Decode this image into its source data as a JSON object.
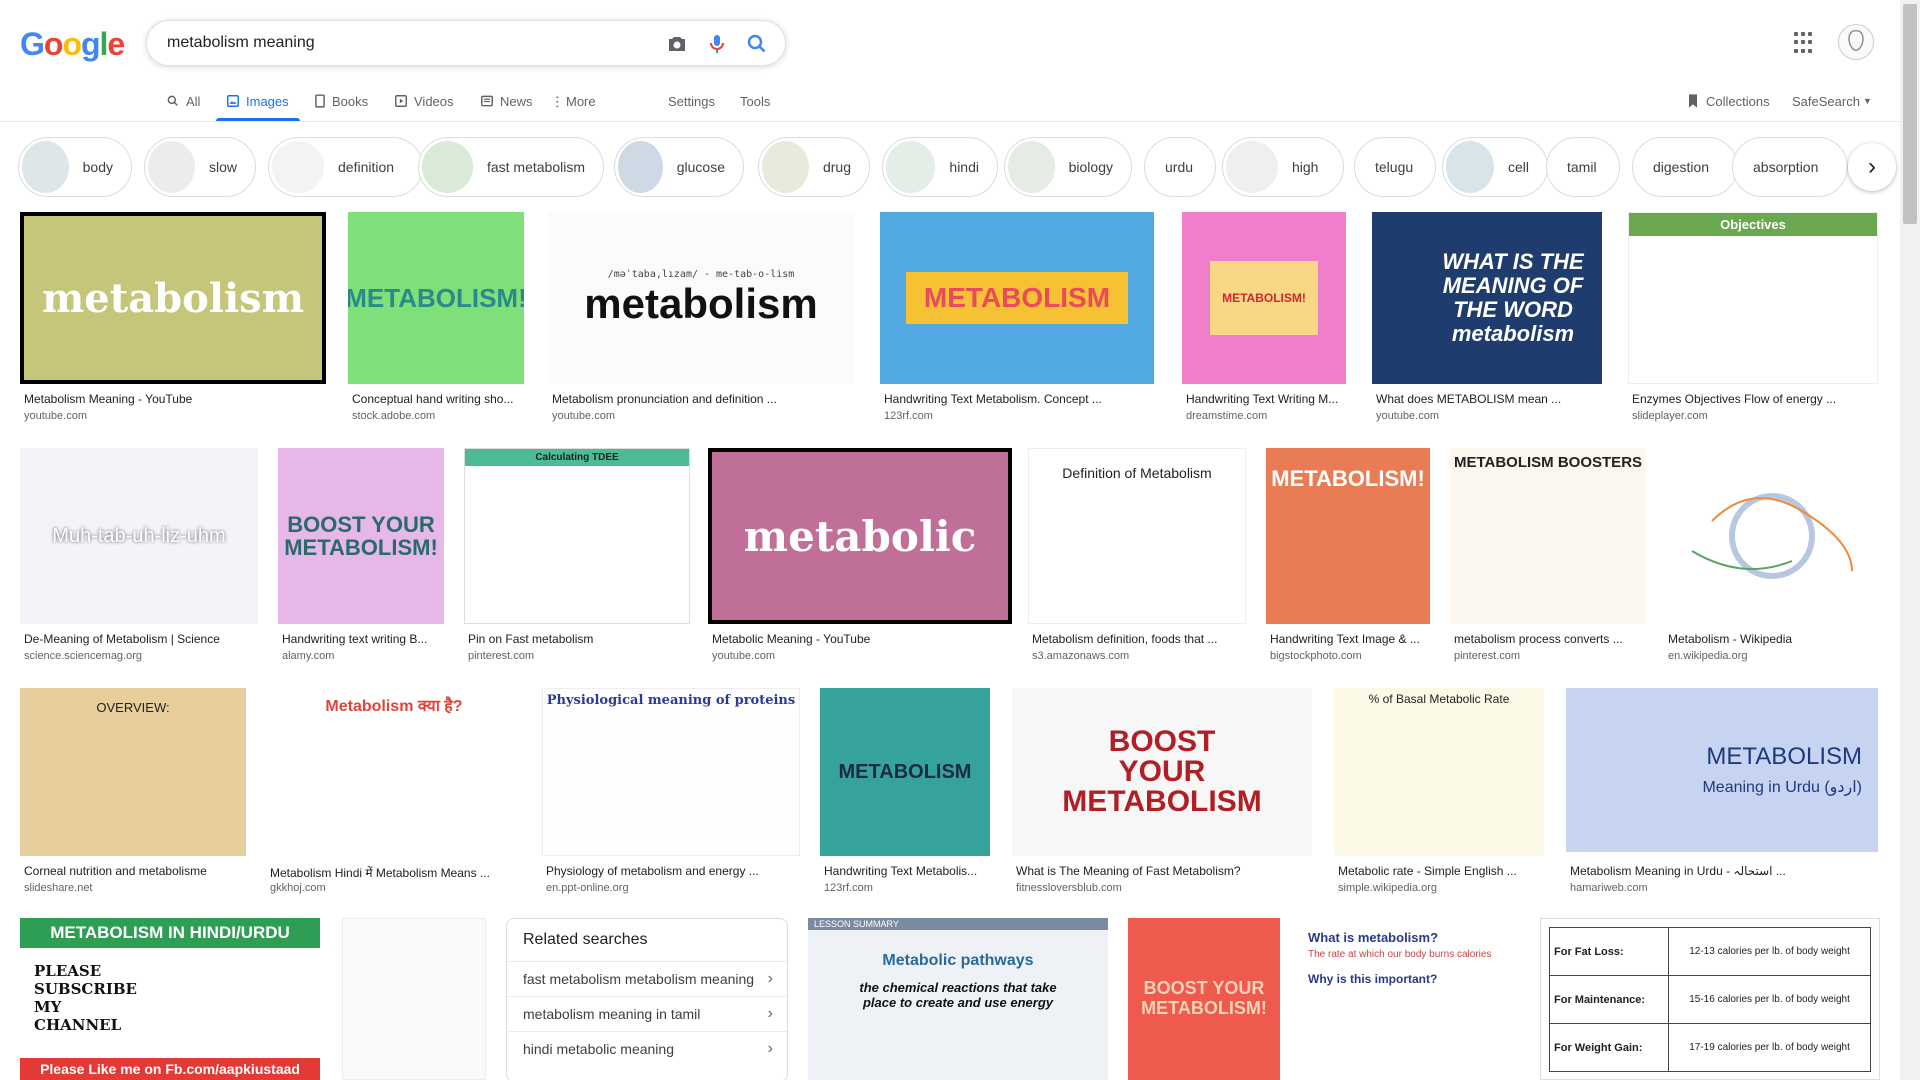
{
  "logo": {
    "letters": [
      "G",
      "o",
      "o",
      "g",
      "l",
      "e"
    ],
    "colors": [
      "#4285F4",
      "#EA4335",
      "#FBBC05",
      "#4285F4",
      "#34A853",
      "#EA4335"
    ]
  },
  "search": {
    "query": "metabolism meaning"
  },
  "tabs": [
    {
      "label": "All",
      "icon": "search-icon"
    },
    {
      "label": "Images",
      "icon": "image-icon"
    },
    {
      "label": "Books",
      "icon": "book-icon"
    },
    {
      "label": "Videos",
      "icon": "video-icon"
    },
    {
      "label": "News",
      "icon": "news-icon"
    },
    {
      "label": "More",
      "icon": "more-icon"
    }
  ],
  "tools": {
    "settings": "Settings",
    "tools": "Tools",
    "collections": "Collections",
    "safesearch": "SafeSearch"
  },
  "chips": [
    "body",
    "slow",
    "definition",
    "fast metabolism",
    "glucose",
    "drug",
    "hindi",
    "biology",
    "urdu",
    "high",
    "telugu",
    "cell",
    "tamil",
    "digestion",
    "absorption"
  ],
  "results": [
    {
      "caption": "Metabolism Meaning - YouTube",
      "source": "youtube.com",
      "img_text": "metabolism"
    },
    {
      "caption": "Conceptual hand writing sho...",
      "source": "stock.adobe.com",
      "img_text": "METABOLISM!"
    },
    {
      "caption": "Metabolism pronunciation and definition ...",
      "source": "youtube.com",
      "img_text": "metabolism",
      "img_sub": "/məˈtaba,lızam/ - me-tab-o-lism"
    },
    {
      "caption": "Handwriting Text Metabolism. Concept ...",
      "source": "123rf.com",
      "img_text": "METABOLISM"
    },
    {
      "caption": "Handwriting Text Writing M...",
      "source": "dreamstime.com",
      "img_text": "METABOLISM!"
    },
    {
      "caption": "What does METABOLISM mean ...",
      "source": "youtube.com",
      "img_text": "WHAT IS THE MEANING OF THE WORD metabolism"
    },
    {
      "caption": "Enzymes Objectives  Flow of energy ...",
      "source": "slideplayer.com",
      "img_text": "Objectives"
    },
    {
      "caption": "De-Meaning of Metabolism | Science",
      "source": "science.sciencemag.org",
      "img_text": "Muh-tab-uh-liz-uhm"
    },
    {
      "caption": "Handwriting text writing B...",
      "source": "alamy.com",
      "img_text": "BOOST YOUR METABOLISM!"
    },
    {
      "caption": "Pin on Fast metabolism",
      "source": "pinterest.com",
      "img_text": "Calculating TDEE"
    },
    {
      "caption": "Metabolic Meaning - YouTube",
      "source": "youtube.com",
      "img_text": "metabolic"
    },
    {
      "caption": "Metabolism definition, foods that ...",
      "source": "s3.amazonaws.com",
      "img_text": "Definition of Metabolism"
    },
    {
      "caption": "Handwriting Text Image & ...",
      "source": "bigstockphoto.com",
      "img_text": "METABOLISM!"
    },
    {
      "caption": "metabolism process converts ...",
      "source": "pinterest.com",
      "img_text": "METABOLISM BOOSTERS"
    },
    {
      "caption": "Metabolism - Wikipedia",
      "source": "en.wikipedia.org",
      "img_text": ""
    },
    {
      "caption": "Corneal nutrition and metabolisme",
      "source": "slideshare.net",
      "img_text": "OVERVIEW:"
    },
    {
      "caption": "Metabolism Hindi में Metabolism Means ...",
      "source": "gkkhoj.com",
      "img_text": "Metabolism क्या है?"
    },
    {
      "caption": "Physiology of metabolism and energy ...",
      "source": "en.ppt-online.org",
      "img_text": "Physiological meaning of proteins"
    },
    {
      "caption": "Handwriting Text Metabolis...",
      "source": "123rf.com",
      "img_text": "METABOLISM"
    },
    {
      "caption": "What is The Meaning of Fast Metabolism?",
      "source": "fitnessloversblub.com",
      "img_text": "BOOST YOUR METABOLISM"
    },
    {
      "caption": "Metabolic rate - Simple English ...",
      "source": "simple.wikipedia.org",
      "img_text": "% of Basal Metabolic Rate"
    },
    {
      "caption": "Metabolism Meaning in Urdu - استحالہ ...",
      "source": "hamariweb.com",
      "img_text": "METABOLISM",
      "img_sub": "Meaning in Urdu (اردو)"
    }
  ],
  "bottom_row": [
    {
      "img_text": "METABOLISM IN HINDI/URDU",
      "img_sub": "PLEASE SUBSCRIBE MY CHANNEL",
      "img_foot": "Please Like me on Fb.com/aapkiustaad"
    },
    {
      "img_text": ""
    },
    {
      "img_text": "Metabolic pathways",
      "img_sub": "the chemical reactions that take place to create and use energy",
      "img_head": "LESSON SUMMARY"
    },
    {
      "img_text": "BOOST YOUR METABOLISM!"
    },
    {
      "img_text": "What is metabolism?",
      "img_sub": "The rate at which our body burns calories",
      "img_sub2": "Why is this important?"
    },
    {
      "rows": [
        [
          "For Fat Loss:",
          "12-13 calories per lb. of body weight"
        ],
        [
          "For Maintenance:",
          "15-16 calories per lb. of body weight"
        ],
        [
          "For Weight Gain:",
          "17-19 calories per lb. of body weight"
        ]
      ]
    }
  ],
  "related": {
    "title": "Related searches",
    "items": [
      "fast metabolism metabolism meaning",
      "metabolism meaning in tamil",
      "hindi metabolic meaning"
    ]
  }
}
